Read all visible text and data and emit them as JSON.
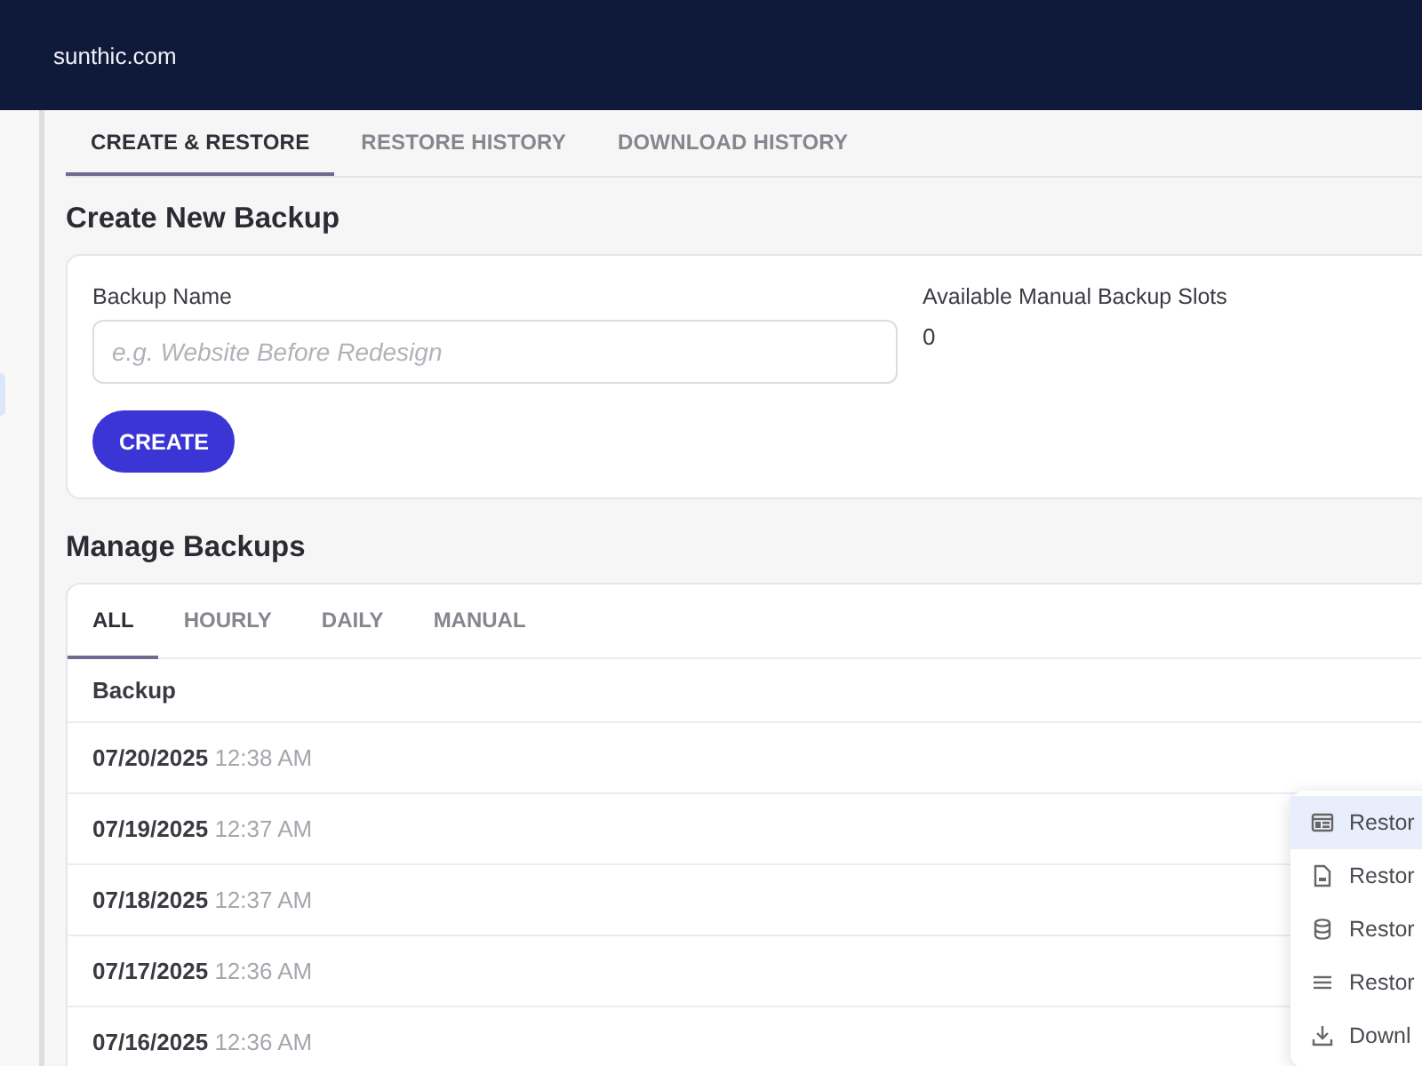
{
  "site": {
    "title": "sunthic.com"
  },
  "tabs": [
    {
      "label": "CREATE & RESTORE",
      "selected": true
    },
    {
      "label": "RESTORE HISTORY",
      "selected": false
    },
    {
      "label": "DOWNLOAD HISTORY",
      "selected": false
    }
  ],
  "create_backup": {
    "heading": "Create New Backup",
    "name_label": "Backup Name",
    "name_placeholder": "e.g. Website Before Redesign",
    "slots_label": "Available Manual Backup Slots",
    "slots_value": "0",
    "button": "CREATE"
  },
  "manage_backups": {
    "heading": "Manage Backups",
    "filters": [
      {
        "label": "ALL",
        "selected": true
      },
      {
        "label": "HOURLY",
        "selected": false
      },
      {
        "label": "DAILY",
        "selected": false
      },
      {
        "label": "MANUAL",
        "selected": false
      }
    ],
    "column": "Backup",
    "rows": [
      {
        "date": "07/20/2025",
        "time": "12:38 AM"
      },
      {
        "date": "07/19/2025",
        "time": "12:37 AM"
      },
      {
        "date": "07/18/2025",
        "time": "12:37 AM"
      },
      {
        "date": "07/17/2025",
        "time": "12:36 AM"
      },
      {
        "date": "07/16/2025",
        "time": "12:36 AM"
      }
    ]
  },
  "context_menu": {
    "items": [
      {
        "label": "Restor",
        "kind": "site",
        "highlighted": true
      },
      {
        "label": "Restor",
        "kind": "file",
        "highlighted": false
      },
      {
        "label": "Restor",
        "kind": "database",
        "highlighted": false
      },
      {
        "label": "Restor",
        "kind": "list",
        "highlighted": false
      },
      {
        "label": "Downl",
        "kind": "download",
        "highlighted": false
      }
    ]
  }
}
